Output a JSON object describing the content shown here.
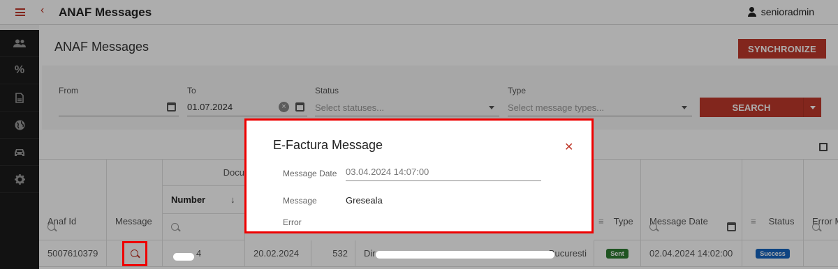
{
  "app": {
    "title": "ANAF Messages",
    "user": "senioradmin"
  },
  "page": {
    "title": "ANAF Messages",
    "sync_label": "SYNCHRONIZE"
  },
  "filters": {
    "from_label": "From",
    "from_value": "",
    "to_label": "To",
    "to_value": "01.07.2024",
    "status_label": "Status",
    "status_placeholder": "Select statuses...",
    "type_label": "Type",
    "type_placeholder": "Select message types...",
    "search_label": "SEARCH"
  },
  "table": {
    "group_header": "Docu",
    "columns": {
      "anaf_id": "Anaf Id",
      "message": "Message",
      "number": "Number",
      "type": "Type",
      "message_date": "Message Date",
      "status": "Status",
      "error": "Error M"
    },
    "rows": [
      {
        "anaf_id": "5007610379",
        "number_suffix": "4",
        "date": "20.02.2024",
        "amount": "532",
        "party_prefix": "Dir",
        "party_suffix": "Bucuresti",
        "type_badge": "Sent",
        "message_date": "02.04.2024 14:02:00",
        "status_badge": "Success"
      }
    ]
  },
  "modal": {
    "title": "E-Factura Message",
    "message_date_label": "Message Date",
    "message_date_value": "03.04.2024 14:07:00",
    "message_label": "Message",
    "message_value": "Greseala",
    "error_label": "Error"
  },
  "colors": {
    "accent": "#c0392b",
    "highlight": "#e00000",
    "success": "#1565c0",
    "sent": "#2e7d32"
  },
  "icons": [
    "menu-icon",
    "back-icon",
    "user-icon",
    "people-icon",
    "percent-icon",
    "document-icon",
    "globe-icon",
    "car-icon",
    "gear-icon",
    "calendar-icon",
    "clear-icon",
    "chevron-down-icon",
    "search-icon",
    "sort-arrow-icon",
    "filter-icon",
    "close-icon",
    "export-icon"
  ]
}
